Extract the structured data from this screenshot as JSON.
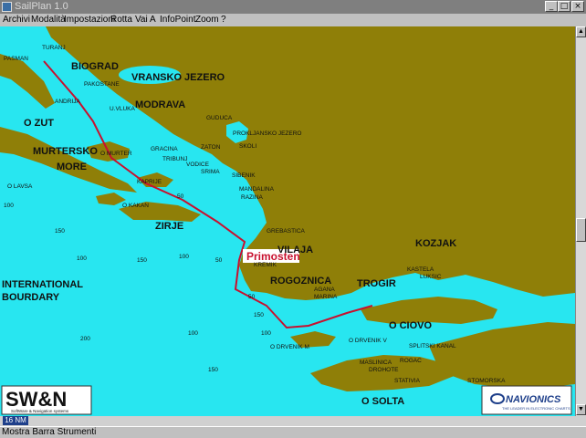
{
  "window": {
    "title": "SailPlan 1.0",
    "btn_min": "_",
    "btn_max": "□",
    "btn_close": "×"
  },
  "menu": [
    "Archivi",
    "Modalità",
    "Impostazioni",
    "Rotta",
    "Vai A",
    "InfoPoint",
    "Zoom",
    "?"
  ],
  "map": {
    "colors": {
      "sea": "#28e6f0",
      "land": "#8f7f08",
      "route": "#c8102e"
    },
    "labels_large": [
      "BIOGRAD",
      "VRANSKO JEZERO",
      "MODRAVA",
      "O ZUT",
      "MURTERSKO",
      "MORE",
      "ZIRJE",
      "VILAJA",
      "KOZJAK",
      "ROGOZNICA",
      "TROGIR",
      "O CIOVO",
      "O SOLTA",
      "INTERNATIONAL",
      "BOURDARY"
    ],
    "labels_small": [
      "PASMAN",
      "TURANJ",
      "PAKOSTANE",
      "ANDRIJA",
      "U.VLUKA",
      "O MURTER",
      "GUDUCA",
      "PROKLJANSKO JEZERO",
      "ZATON",
      "SKOLI",
      "GRACINA",
      "TRIBUNJ",
      "VODICE",
      "SRIMA",
      "SIBENIK",
      "O LAVSA",
      "KAPRIJE",
      "O KAKAN",
      "MANDALINA",
      "RAZINA",
      "GREBASTICA",
      "KREMIK",
      "AGANA",
      "MARINA",
      "KASTELA",
      "LUKSIC",
      "O DRVENIK V",
      "O DRVENIK M",
      "SPLITSKI KANAL",
      "MASLINICA",
      "DROHOTE",
      "ROGAC",
      "STATIVIA",
      "STOMORSKA"
    ],
    "depths": [
      "100",
      "50",
      "100",
      "150",
      "150",
      "100",
      "50",
      "200",
      "100",
      "150",
      "50",
      "100",
      "100",
      "150"
    ],
    "route_label": "Primosten",
    "logo_swn": {
      "big": "SW&N",
      "small": "SoftWare & Navigation systems"
    },
    "logo_navionics": {
      "big": "NAVIONICS",
      "small": "THE LEADER IN ELECTRONIC CHARTS"
    }
  },
  "scale_label": "16 NM",
  "status": "Mostra Barra Strumenti"
}
